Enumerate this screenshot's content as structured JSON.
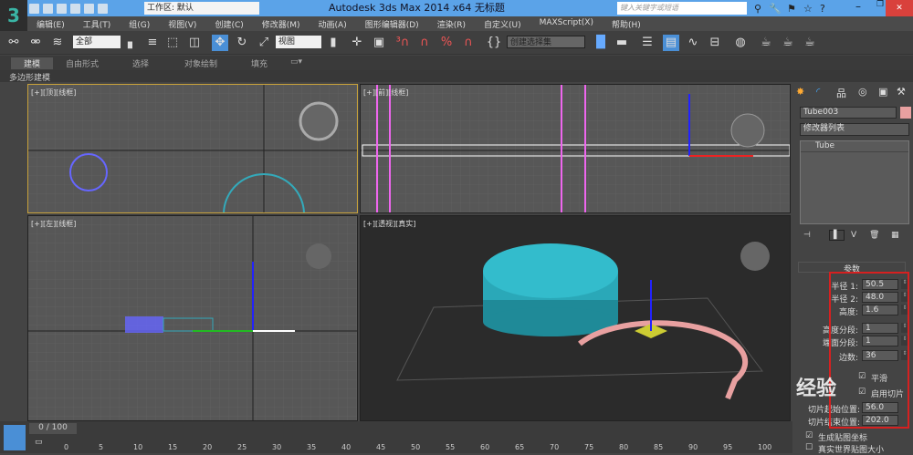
{
  "titlebar": {
    "title": "Autodesk 3ds Max  2014 x64      无标题",
    "workspace": "工作区: 默认",
    "search_placeholder": "键入关键字或短语"
  },
  "menu": [
    "编辑(E)",
    "工具(T)",
    "组(G)",
    "视图(V)",
    "创建(C)",
    "修改器(M)",
    "动画(A)",
    "图形编辑器(D)",
    "渲染(R)",
    "自定义(U)",
    "MAXScript(X)",
    "帮助(H)"
  ],
  "toolbar": {
    "selection_filter": "全部",
    "ref_coord": "视图",
    "named_selection": "创建选择集"
  },
  "ribbon": {
    "tabs": [
      "建模",
      "自由形式",
      "选择",
      "对象绘制",
      "填充"
    ],
    "active": "建模",
    "sub": "多边形建模"
  },
  "viewports": [
    {
      "label": "[+][顶][线框]",
      "active": true
    },
    {
      "label": "[+][前][线框]"
    },
    {
      "label": "[+][左][线框]"
    },
    {
      "label": "[+][透视][真实]"
    }
  ],
  "panel": {
    "object_name": "Tube003",
    "object_color": "#e8a0a0",
    "modifier_list": "修改器列表",
    "stack_item": "Tube",
    "rollout": "参数",
    "params": [
      {
        "label": "半径 1:",
        "value": "50.5"
      },
      {
        "label": "半径 2:",
        "value": "48.0"
      },
      {
        "label": "高度:",
        "value": "1.6"
      },
      {
        "label": "高度分段:",
        "value": "1"
      },
      {
        "label": "端面分段:",
        "value": "1"
      },
      {
        "label": "边数:",
        "value": "36"
      }
    ],
    "smooth": "平滑",
    "slice_on": "启用切片",
    "slice_from_label": "切片起始位置:",
    "slice_from": "56.0",
    "slice_to_label": "切片结束位置:",
    "slice_to": "202.0",
    "gen_map": "生成贴图坐标",
    "real_world": "真实世界贴图大小"
  },
  "timeline": {
    "frame": "0 / 100",
    "ticks": [
      "0",
      "5",
      "10",
      "15",
      "20",
      "25",
      "30",
      "35",
      "40",
      "45",
      "50",
      "55",
      "60",
      "65",
      "70",
      "75",
      "80",
      "85",
      "90",
      "95",
      "100"
    ]
  },
  "watermark": "Baidu经验 jingyan.baidu.com"
}
